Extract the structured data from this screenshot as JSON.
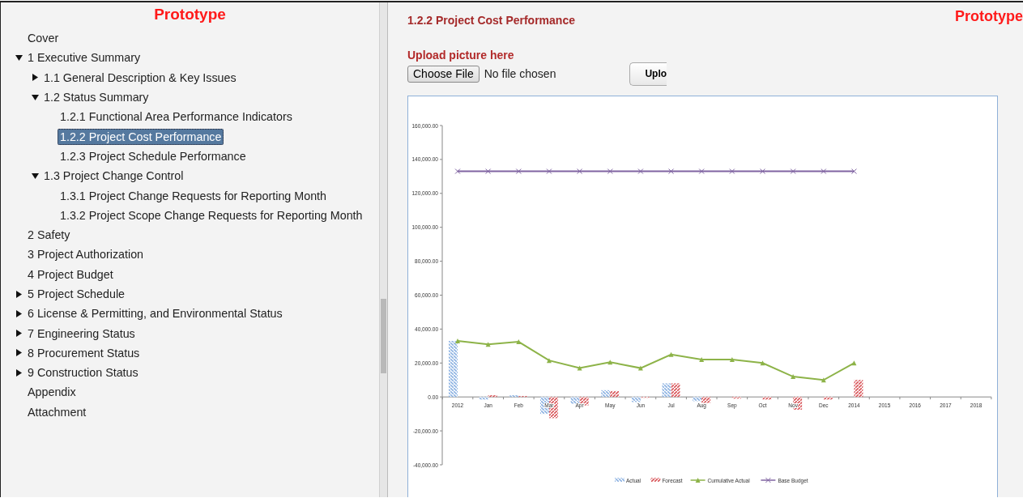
{
  "sidebar": {
    "title": "Prototype",
    "items": [
      {
        "label": "Cover",
        "kind": "page",
        "selected": false
      },
      {
        "label": "1 Executive Summary",
        "kind": "folder",
        "expanded": true,
        "selected": false,
        "children": [
          {
            "label": "1.1 General Description & Key Issues",
            "kind": "folder",
            "expanded": false,
            "selected": false
          },
          {
            "label": "1.2 Status Summary",
            "kind": "folder",
            "expanded": true,
            "selected": false,
            "children": [
              {
                "label": "1.2.1 Functional Area Performance Indicators",
                "kind": "page",
                "selected": false
              },
              {
                "label": "1.2.2 Project Cost Performance",
                "kind": "page",
                "selected": true
              },
              {
                "label": "1.2.3 Project Schedule Performance",
                "kind": "page",
                "selected": false
              }
            ]
          },
          {
            "label": "1.3 Project Change Control",
            "kind": "folder",
            "expanded": true,
            "selected": false,
            "children": [
              {
                "label": "1.3.1 Project Change Requests for Reporting Month",
                "kind": "page",
                "selected": false
              },
              {
                "label": "1.3.2 Project Scope Change Requests for Reporting Month",
                "kind": "page",
                "selected": false
              }
            ]
          }
        ]
      },
      {
        "label": "2 Safety",
        "kind": "page",
        "selected": false
      },
      {
        "label": "3 Project Authorization",
        "kind": "page",
        "selected": false
      },
      {
        "label": "4 Project Budget",
        "kind": "page",
        "selected": false
      },
      {
        "label": "5 Project Schedule",
        "kind": "folder",
        "expanded": false,
        "selected": false
      },
      {
        "label": "6 License & Permitting, and Environmental Status",
        "kind": "folder",
        "expanded": false,
        "selected": false
      },
      {
        "label": "7 Engineering Status",
        "kind": "folder",
        "expanded": false,
        "selected": false
      },
      {
        "label": "8 Procurement Status",
        "kind": "folder",
        "expanded": false,
        "selected": false
      },
      {
        "label": "9 Construction Status",
        "kind": "folder",
        "expanded": false,
        "selected": false
      },
      {
        "label": "Appendix",
        "kind": "page",
        "selected": false
      },
      {
        "label": "Attachment",
        "kind": "page",
        "selected": false
      }
    ]
  },
  "content": {
    "heading": "1.2.2 Project Cost Performance",
    "watermark": "Prototype",
    "upload_label": "Upload picture here",
    "file_button": "Choose File",
    "file_status": "No file chosen",
    "upload_button": "Uplo",
    "chart_data": {
      "type": "bar",
      "categories": [
        "2012",
        "Jan",
        "Feb",
        "Mar",
        "Apr",
        "May",
        "Jun",
        "Jul",
        "Aug",
        "Sep",
        "Oct",
        "Nov",
        "Dec",
        "2014",
        "2015",
        "2016",
        "2017",
        "2018"
      ],
      "ylim": [
        -40000,
        160000
      ],
      "stacked": false,
      "legend": "bottom",
      "yticks": [
        {
          "value": -40000,
          "label": "-40,000.00"
        },
        {
          "value": -20000,
          "label": "-20,000.00"
        },
        {
          "value": 0,
          "label": "0.00"
        },
        {
          "value": 20000,
          "label": "20,000.00"
        },
        {
          "value": 40000,
          "label": "40,000.00"
        },
        {
          "value": 60000,
          "label": "60,000.00"
        },
        {
          "value": 80000,
          "label": "80,000.00"
        },
        {
          "value": 100000,
          "label": "100,000.00"
        },
        {
          "value": 120000,
          "label": "120,000.00"
        },
        {
          "value": 140000,
          "label": "140,000.00"
        },
        {
          "value": 160000,
          "label": "160,000.00"
        }
      ],
      "series": [
        {
          "name": "Actual",
          "type": "bar",
          "color": "#8fb4e3",
          "values": [
            33000,
            -1500,
            1000,
            -10000,
            -4000,
            4000,
            -3000,
            8000,
            -2500,
            null,
            null,
            null,
            null,
            null,
            null,
            null,
            null,
            null
          ]
        },
        {
          "name": "Forecast",
          "type": "bar",
          "color": "#d9585c",
          "values": [
            null,
            1000,
            500,
            -12500,
            -5000,
            3500,
            -500,
            8000,
            -3500,
            -1000,
            -1500,
            -7500,
            -1500,
            10000,
            null,
            null,
            null,
            null
          ]
        },
        {
          "name": "Cumulative Actual",
          "type": "line",
          "marker": "triangle",
          "color": "#8db348",
          "values": [
            33000,
            31000,
            32500,
            21500,
            17000,
            20500,
            17000,
            25000,
            22000,
            22000,
            20000,
            12000,
            10000,
            20000,
            null,
            null,
            null,
            null
          ]
        },
        {
          "name": "Base Budget",
          "type": "line",
          "marker": "x",
          "color": "#8064a2",
          "values": [
            133000,
            133000,
            133000,
            133000,
            133000,
            133000,
            133000,
            133000,
            133000,
            133000,
            133000,
            133000,
            133000,
            133000,
            null,
            null,
            null,
            null
          ]
        }
      ]
    }
  }
}
